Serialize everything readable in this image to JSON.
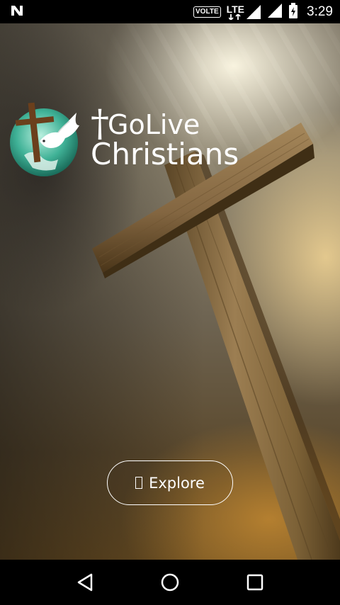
{
  "status_bar": {
    "volte_label": "VOLTE",
    "network_label": "LTE",
    "time": "3:29",
    "icons": [
      "n-notification-icon",
      "volte-icon",
      "lte-signal-icon",
      "signal-icon",
      "battery-icon"
    ]
  },
  "app": {
    "logo_line1": "GoLive",
    "logo_line1_prefix": "†",
    "logo_line2": "Christians",
    "explore_label": "Explore",
    "explore_icon": "missing-glyph-icon"
  },
  "nav_bar": {
    "buttons": [
      "back-icon",
      "home-icon",
      "recents-icon"
    ]
  },
  "colors": {
    "text": "#ffffff",
    "status_bar_bg": "#000000",
    "nav_bar_bg": "#000000"
  }
}
